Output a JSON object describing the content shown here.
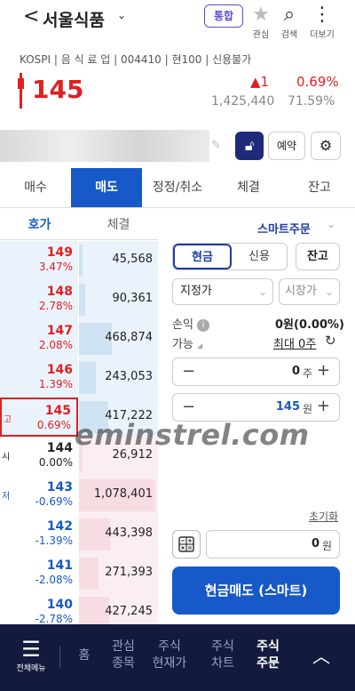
{
  "header": {
    "back": "<",
    "stock_name": "서울식품",
    "dropdown": "⌄",
    "badge": "통합",
    "icons": [
      {
        "name": "star-icon",
        "glyph": "★",
        "label": "관심"
      },
      {
        "name": "search-icon",
        "glyph": "⌕",
        "label": "검색"
      },
      {
        "name": "more-icon",
        "glyph": "⋮",
        "label": "더보기"
      }
    ]
  },
  "info": {
    "line": "KOSPI | 음 식 료 업 | 004410 | 현100 | 신용불가",
    "price": "145",
    "change": "▲1",
    "change_pct": "0.69%",
    "volume": "1,425,440",
    "rate": "71.59%"
  },
  "account": {
    "reserve": "예약"
  },
  "tabs": [
    "매수",
    "매도",
    "정정/취소",
    "체결",
    "잔고"
  ],
  "orderbook": {
    "head": [
      "호가",
      "체결"
    ],
    "rows": [
      {
        "price": "149",
        "pct": "3.47%",
        "vol": "45,568",
        "side": "sell",
        "color": "red",
        "bar": 0.05
      },
      {
        "price": "148",
        "pct": "2.78%",
        "vol": "90,361",
        "side": "sell",
        "color": "red",
        "bar": 0.08
      },
      {
        "price": "147",
        "pct": "2.08%",
        "vol": "468,874",
        "side": "sell",
        "color": "red",
        "bar": 0.43
      },
      {
        "price": "146",
        "pct": "1.39%",
        "vol": "243,053",
        "side": "sell",
        "color": "red",
        "bar": 0.22
      },
      {
        "price": "145",
        "pct": "0.69%",
        "vol": "417,222",
        "side": "sell",
        "color": "red",
        "bar": 0.38,
        "mark": "고",
        "highlight": true
      },
      {
        "price": "144",
        "pct": "0.00%",
        "vol": "26,912",
        "side": "buy",
        "color": "blk",
        "bar": 0.02,
        "mark": "시"
      },
      {
        "price": "143",
        "pct": "-0.69%",
        "vol": "1,078,401",
        "side": "buy",
        "color": "blue",
        "bar": 1.0,
        "mark": "저"
      },
      {
        "price": "142",
        "pct": "-1.39%",
        "vol": "443,398",
        "side": "buy",
        "color": "blue",
        "bar": 0.41
      },
      {
        "price": "141",
        "pct": "-2.08%",
        "vol": "271,393",
        "side": "buy",
        "color": "blue",
        "bar": 0.25
      },
      {
        "price": "140",
        "pct": "-2.78%",
        "vol": "427,245",
        "side": "buy",
        "color": "blue",
        "bar": 0.4
      }
    ]
  },
  "form": {
    "smart_order": "스마트주문",
    "segment": [
      "현금",
      "신용"
    ],
    "balance_btn": "잔고",
    "order_type": "지정가",
    "market_price": "시장가",
    "pnl_label": "손익",
    "pnl_value": "0원(0.00%)",
    "avail_label": "가능",
    "max_qty": "최대 0주",
    "qty_value": "0",
    "qty_unit": "주",
    "price_value": "145",
    "price_unit": "원",
    "reset": "초기화",
    "amount_value": "0",
    "amount_unit": "원",
    "sell_button": "현금매도 (스마트)"
  },
  "watermark": "eminstrel.com",
  "nav": {
    "menu_label": "전체메뉴",
    "items": [
      {
        "l1": "홈",
        "l2": ""
      },
      {
        "l1": "관심",
        "l2": "종목"
      },
      {
        "l1": "주식",
        "l2": "현재가"
      },
      {
        "l1": "주식",
        "l2": "차트"
      },
      {
        "l1": "주식",
        "l2": "주문"
      }
    ],
    "active": 4
  },
  "colors": {
    "accent": "#1759c8",
    "up": "#e02020",
    "navy": "#141a3e"
  }
}
